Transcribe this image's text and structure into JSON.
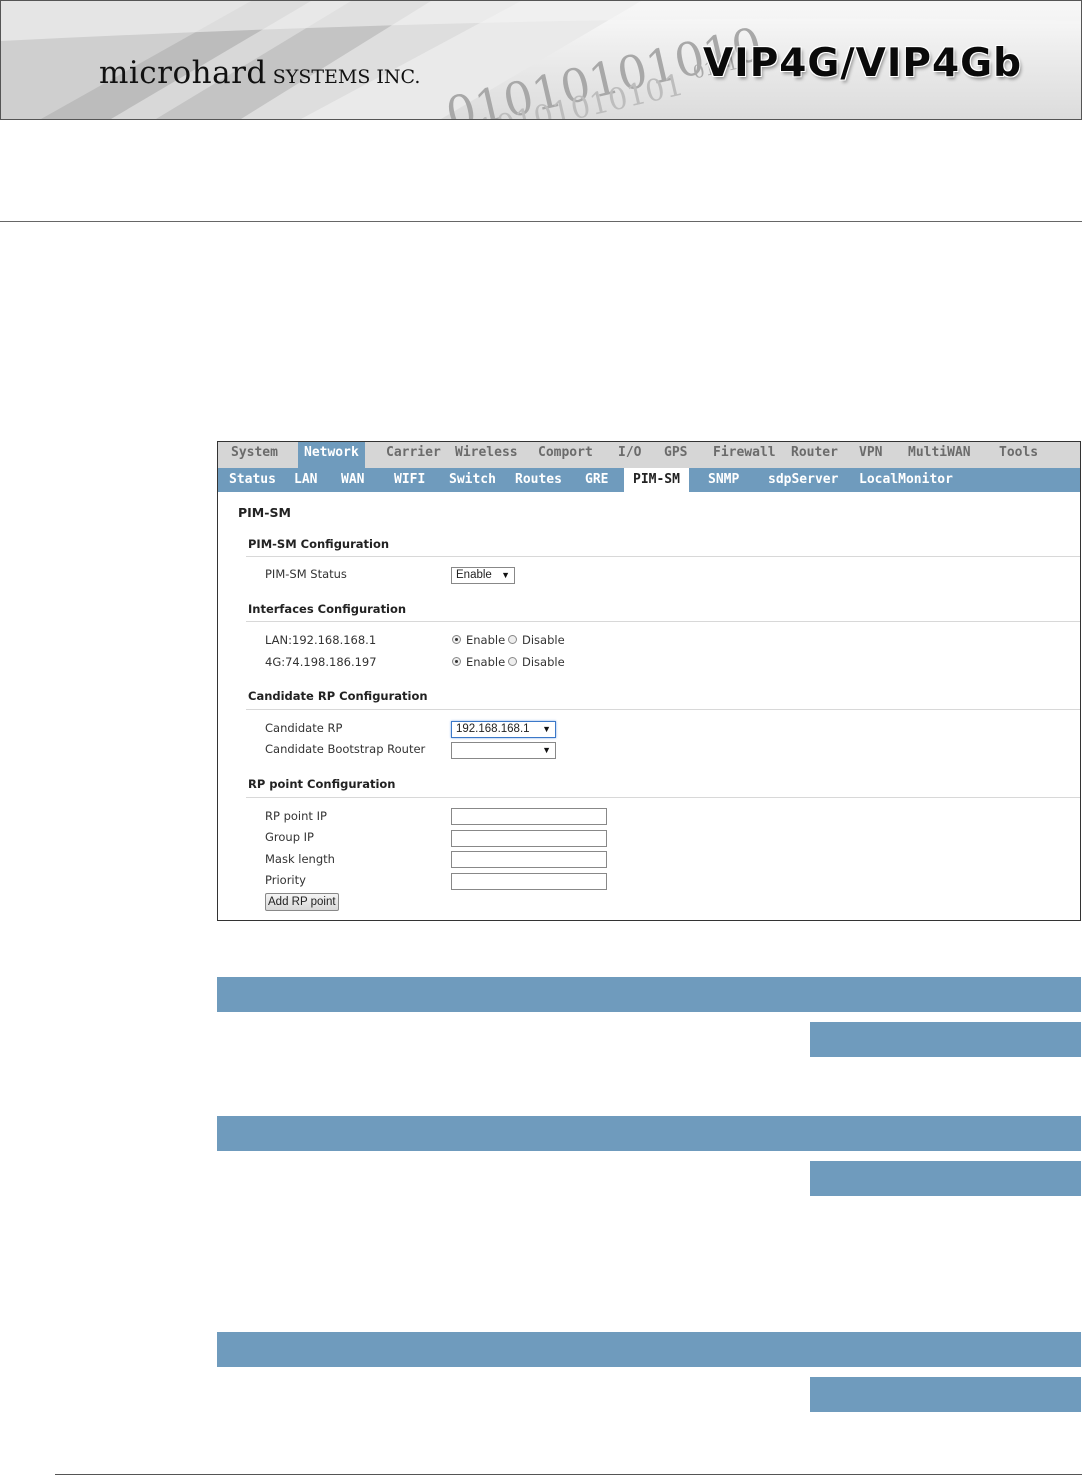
{
  "banner": {
    "company_main": "microhard",
    "company_sub": "SYSTEMS INC.",
    "product": "VIP4G/VIP4Gb",
    "binary_1": "01010101010",
    "binary_2": "010101010101",
    "binary_3": "0101"
  },
  "nav": {
    "main_tabs": [
      "System",
      "Network",
      "Carrier",
      "Wireless",
      "Comport",
      "I/O",
      "GPS",
      "Firewall",
      "Router",
      "VPN",
      "MultiWAN",
      "Tools"
    ],
    "main_active": "Network",
    "sub_tabs": [
      "Status",
      "LAN",
      "WAN",
      "WIFI",
      "Switch",
      "Routes",
      "GRE",
      "PIM-SM",
      "SNMP",
      "sdpServer",
      "LocalMonitor"
    ],
    "sub_active": "PIM-SM"
  },
  "page": {
    "title": "PIM-SM",
    "section_pimsm": "PIM-SM Configuration",
    "pimsm_status_label": "PIM-SM Status",
    "pimsm_status_value": "Enable",
    "section_interfaces": "Interfaces Configuration",
    "interfaces": [
      {
        "name": "LAN:192.168.168.1",
        "enable": "Enable",
        "disable": "Disable",
        "selected": "Enable"
      },
      {
        "name": "4G:74.198.186.197",
        "enable": "Enable",
        "disable": "Disable",
        "selected": "Enable"
      }
    ],
    "section_candidate": "Candidate RP Configuration",
    "candidate_rp_label": "Candidate RP",
    "candidate_rp_value": "192.168.168.1",
    "candidate_bsr_label": "Candidate Bootstrap Router",
    "candidate_bsr_value": "",
    "section_rp": "RP point Configuration",
    "rp_point_ip_label": "RP point IP",
    "group_ip_label": "Group IP",
    "mask_length_label": "Mask length",
    "priority_label": "Priority",
    "add_button": "Add RP point"
  },
  "colors": {
    "accent_blue": "#6f9bbd",
    "tab_grey": "#d6d6d6"
  }
}
